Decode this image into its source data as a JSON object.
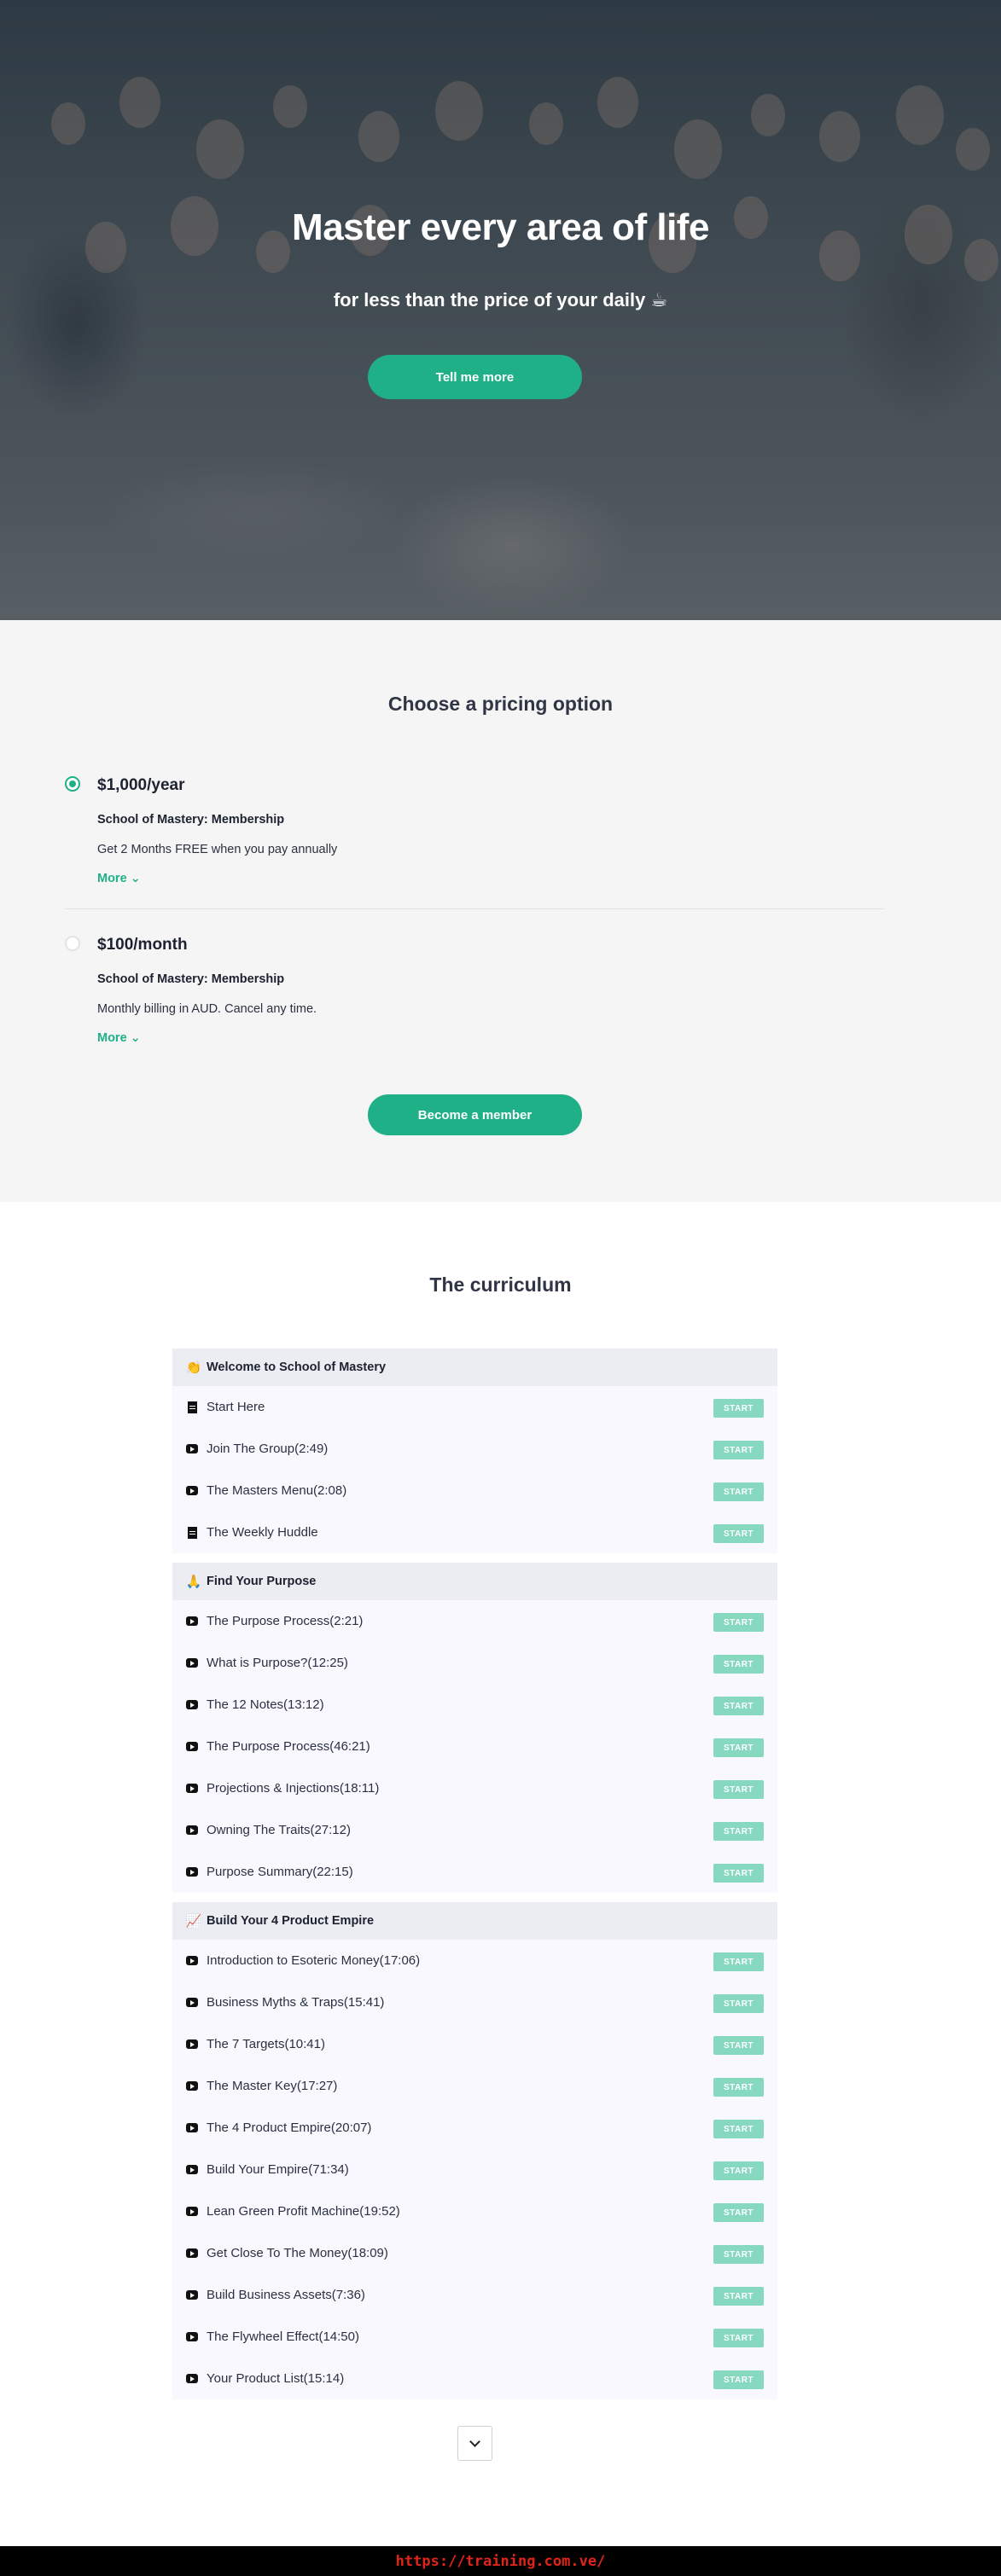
{
  "hero": {
    "title": "Master every area of life",
    "subtitle": "for less than the price of your daily ☕",
    "cta_label": "Tell me more"
  },
  "pricing": {
    "title": "Choose a pricing option",
    "options": [
      {
        "price": "$1,000/year",
        "plan": "School of Mastery: Membership",
        "description": "Get 2 Months FREE when you pay annually",
        "more": "More ⌄",
        "selected": true
      },
      {
        "price": "$100/month",
        "plan": "School of Mastery: Membership",
        "description": "Monthly billing in AUD. Cancel any time.",
        "more": "More ⌄",
        "selected": false
      }
    ],
    "button_label": "Become a member"
  },
  "curriculum": {
    "title": "The curriculum",
    "start_label": "START",
    "sections": [
      {
        "emoji": "👏",
        "title": "Welcome to School of Mastery",
        "lessons": [
          {
            "type": "doc",
            "title": "Start Here"
          },
          {
            "type": "video",
            "title": "Join The Group(2:49)"
          },
          {
            "type": "video",
            "title": "The Masters Menu(2:08)"
          },
          {
            "type": "doc",
            "title": "The Weekly Huddle"
          }
        ]
      },
      {
        "emoji": "🙏",
        "title": "Find Your Purpose",
        "lessons": [
          {
            "type": "video",
            "title": "The Purpose Process(2:21)"
          },
          {
            "type": "video",
            "title": "What is Purpose?(12:25)"
          },
          {
            "type": "video",
            "title": "The 12 Notes(13:12)"
          },
          {
            "type": "video",
            "title": "The Purpose Process(46:21)"
          },
          {
            "type": "video",
            "title": "Projections & Injections(18:11)"
          },
          {
            "type": "video",
            "title": "Owning The Traits(27:12)"
          },
          {
            "type": "video",
            "title": "Purpose Summary(22:15)"
          }
        ]
      },
      {
        "emoji": "📈",
        "title": "Build Your 4 Product Empire",
        "lessons": [
          {
            "type": "video",
            "title": "Introduction to Esoteric Money(17:06)"
          },
          {
            "type": "video",
            "title": "Business Myths & Traps(15:41)"
          },
          {
            "type": "video",
            "title": "The 7 Targets(10:41)"
          },
          {
            "type": "video",
            "title": "The Master Key(17:27)"
          },
          {
            "type": "video",
            "title": "The 4 Product Empire(20:07)"
          },
          {
            "type": "video",
            "title": "Build Your Empire(71:34)"
          },
          {
            "type": "video",
            "title": "Lean Green Profit Machine(19:52)"
          },
          {
            "type": "video",
            "title": "Get Close To The Money(18:09)"
          },
          {
            "type": "video",
            "title": "Build Business Assets(7:36)"
          },
          {
            "type": "video",
            "title": "The Flywheel Effect(14:50)"
          },
          {
            "type": "video",
            "title": "Your Product List(15:14)"
          }
        ]
      }
    ],
    "expand_icon": "chevron-down-icon"
  },
  "footer": {
    "watermark": "https://training.com.ve/"
  },
  "colors": {
    "accent": "#1fb087",
    "start_button": "#86d8bf",
    "section_bg": "#ececf3",
    "lesson_bg": "#f8f8fe",
    "pricing_bg": "#f5f5f5"
  }
}
